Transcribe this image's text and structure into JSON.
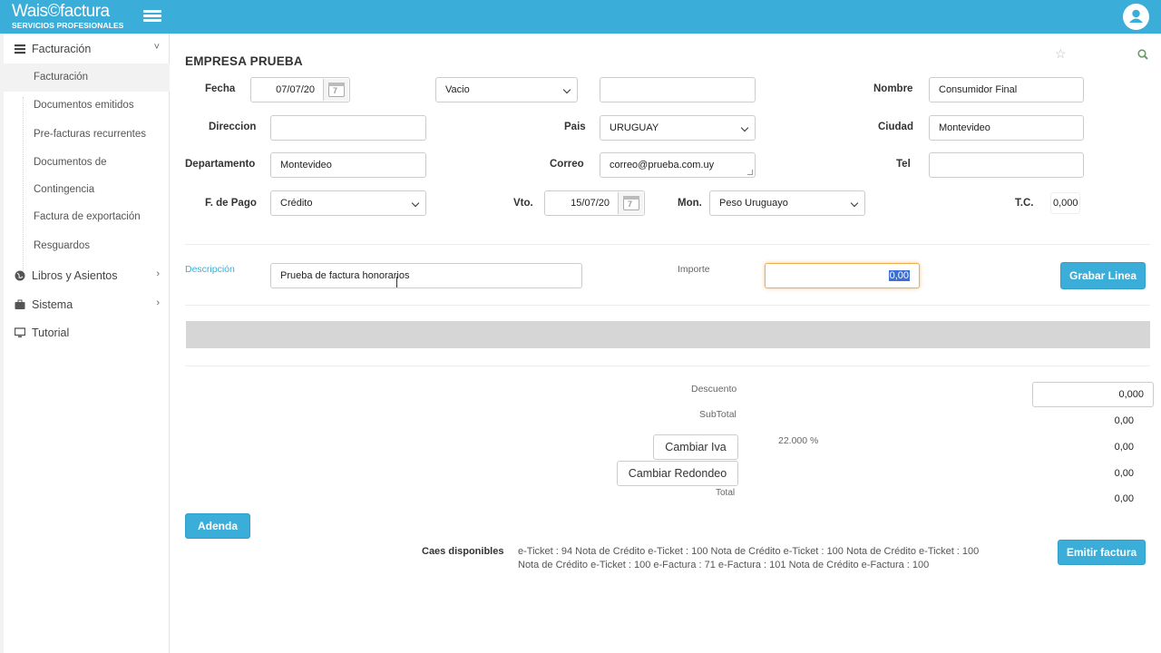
{
  "header": {
    "brand": "Wais©factura",
    "brand_sub": "SERVICIOS PROFESIONALES",
    "accent": "#3aaed8"
  },
  "sidebar": {
    "groups": [
      {
        "label": "Facturación",
        "icon": "list-icon",
        "chevron": "˅"
      },
      {
        "label": "Libros y Asientos",
        "icon": "globe-icon",
        "chevron": "›"
      },
      {
        "label": "Sistema",
        "icon": "briefcase-icon",
        "chevron": "›"
      },
      {
        "label": "Tutorial",
        "icon": "monitor-icon",
        "chevron": ""
      }
    ],
    "items": [
      {
        "label": "Facturación"
      },
      {
        "label": "Documentos emitidos"
      },
      {
        "label": "Pre-facturas recurrentes"
      },
      {
        "label": "Documentos de"
      },
      {
        "label": "Contingencia"
      },
      {
        "label": "Factura de exportación"
      },
      {
        "label": "Resguardos"
      }
    ]
  },
  "form": {
    "company": "EMPRESA PRUEBA",
    "labels": {
      "fecha": "Fecha",
      "nombre": "Nombre",
      "direccion": "Direccion",
      "pais": "Pais",
      "ciudad": "Ciudad",
      "departamento": "Departamento",
      "correo": "Correo",
      "tel": "Tel",
      "fpago": "F. de Pago",
      "vto": "Vto.",
      "mon": "Mon.",
      "tc": "T.C."
    },
    "values": {
      "fecha": "07/07/20",
      "vacio": "Vacio",
      "blank_top": "",
      "nombre": "Consumidor Final",
      "direccion": "",
      "pais": "URUGUAY",
      "ciudad": "Montevideo",
      "departamento": "Montevideo",
      "correo": "correo@prueba.com.uy",
      "tel": "",
      "fpago": "Crédito",
      "vto": "15/07/20",
      "mon": "Peso Uruguayo",
      "tc": "0,000",
      "cal_num": "7"
    }
  },
  "line": {
    "descripcion_label": "Descripción",
    "descripcion_value": "Prueba de factura honorarios",
    "importe_label": "Importe",
    "importe_value": "0,00",
    "grabar_label": "Grabar Linea"
  },
  "totals": {
    "descuento_label": "Descuento",
    "descuento_value": "0,000",
    "subtotal_label": "SubTotal",
    "subtotal_value": "0,00",
    "iva_rate": "22.000 %",
    "iva_value": "0,00",
    "cambiar_iva": "Cambiar Iva",
    "redondeo_value": "0,00",
    "cambiar_redondeo": "Cambiar Redondeo",
    "total_label": "Total",
    "total_value": "0,00"
  },
  "footer": {
    "adenda": "Adenda",
    "caes_label": "Caes disponibles",
    "caes_text": "e-Ticket : 94 Nota de Crédito e-Ticket : 100 Nota de Crédito e-Ticket : 100 Nota de Crédito e-Ticket : 100 Nota de Crédito e-Ticket : 100 e-Factura : 71 e-Factura : 101 Nota de Crédito e-Factura : 100",
    "emitir": "Emitir factura"
  }
}
